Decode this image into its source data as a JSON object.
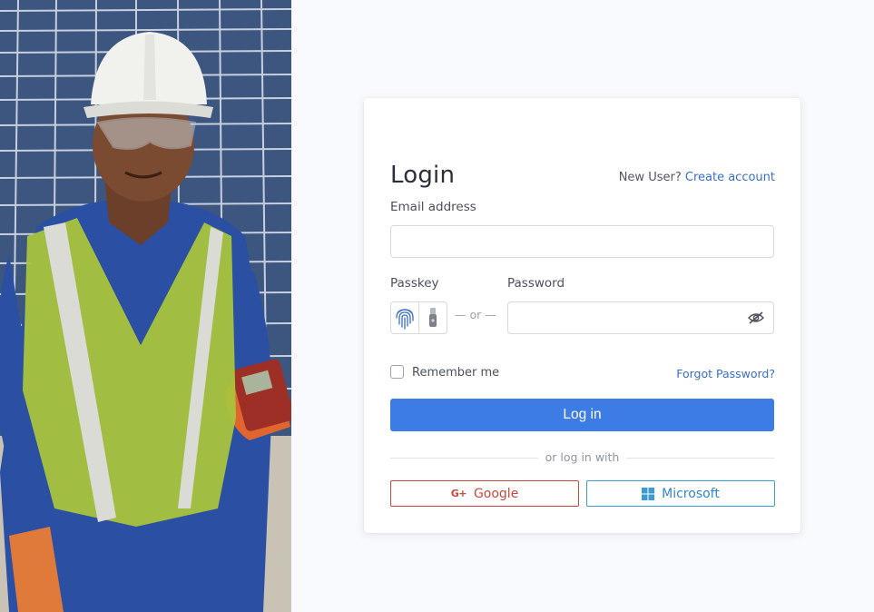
{
  "hero_image": {
    "name": "solar-technician-photo"
  },
  "login": {
    "title": "Login",
    "new_user_text": "New User?",
    "create_account_link": "Create account",
    "email_label": "Email address",
    "email_value": "",
    "passkey_label": "Passkey",
    "or_text": "— or —",
    "password_label": "Password",
    "password_value": "",
    "remember_label": "Remember me",
    "forgot_link": "Forgot Password?",
    "login_button": "Log in",
    "alt_login_text": "or log in with",
    "google_button": "Google",
    "microsoft_button": "Microsoft"
  },
  "colors": {
    "primary": "#3d7be5",
    "link": "#3a6ec8",
    "google": "#c9473d",
    "microsoft": "#2f86c4"
  },
  "icons": [
    "fingerprint-icon",
    "security-key-icon",
    "eye-off-icon",
    "google-plus-icon",
    "windows-icon"
  ]
}
